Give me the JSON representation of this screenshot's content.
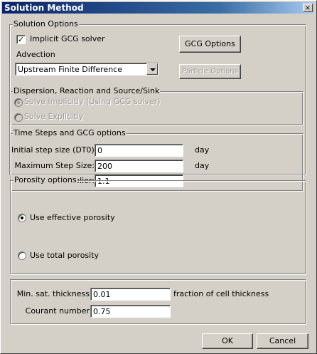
{
  "window": {
    "title": "Solution Method",
    "close_glyph": "×"
  },
  "solution_options": {
    "label": "Solution Options",
    "implicit_gcg": {
      "label": "Implicit GCG solver",
      "checked": true
    },
    "gcg_options_button": "GCG Options",
    "advection_label": "Advection",
    "advection_value": "Upstream Finite Difference",
    "particle_options_button": "Particle Options"
  },
  "dispersion": {
    "label": "Dispersion, Reaction and Source/Sink",
    "options": [
      {
        "label": "Solve Implicitly (Using GCG solver)",
        "selected": true
      },
      {
        "label": "Solve Explicitly",
        "selected": false
      }
    ]
  },
  "time_steps": {
    "label": "Time Steps and GCG options",
    "fields": [
      {
        "label": "Initial step size (DT0):",
        "value": "0",
        "unit": "day"
      },
      {
        "label": "Maximum Step Size:",
        "value": "200",
        "unit": "day"
      },
      {
        "label": "Multiplier:",
        "value": "1.1",
        "unit": ""
      }
    ]
  },
  "porosity": {
    "label": "Porosity options",
    "options": [
      {
        "label": "Use effective porosity",
        "selected": true
      },
      {
        "label": "Use total porosity",
        "selected": false
      }
    ]
  },
  "saturation": {
    "min_sat_label": "Min. sat. thickness",
    "min_sat_value": "0.01",
    "min_sat_unit": "fraction of cell thickness",
    "courant_label": "Courant number",
    "courant_value": "0.75"
  },
  "buttons": {
    "ok": "OK",
    "cancel": "Cancel"
  },
  "icons": {
    "checkbox_checked": "check-mark",
    "dropdown": "chevron-down",
    "close": "close"
  }
}
